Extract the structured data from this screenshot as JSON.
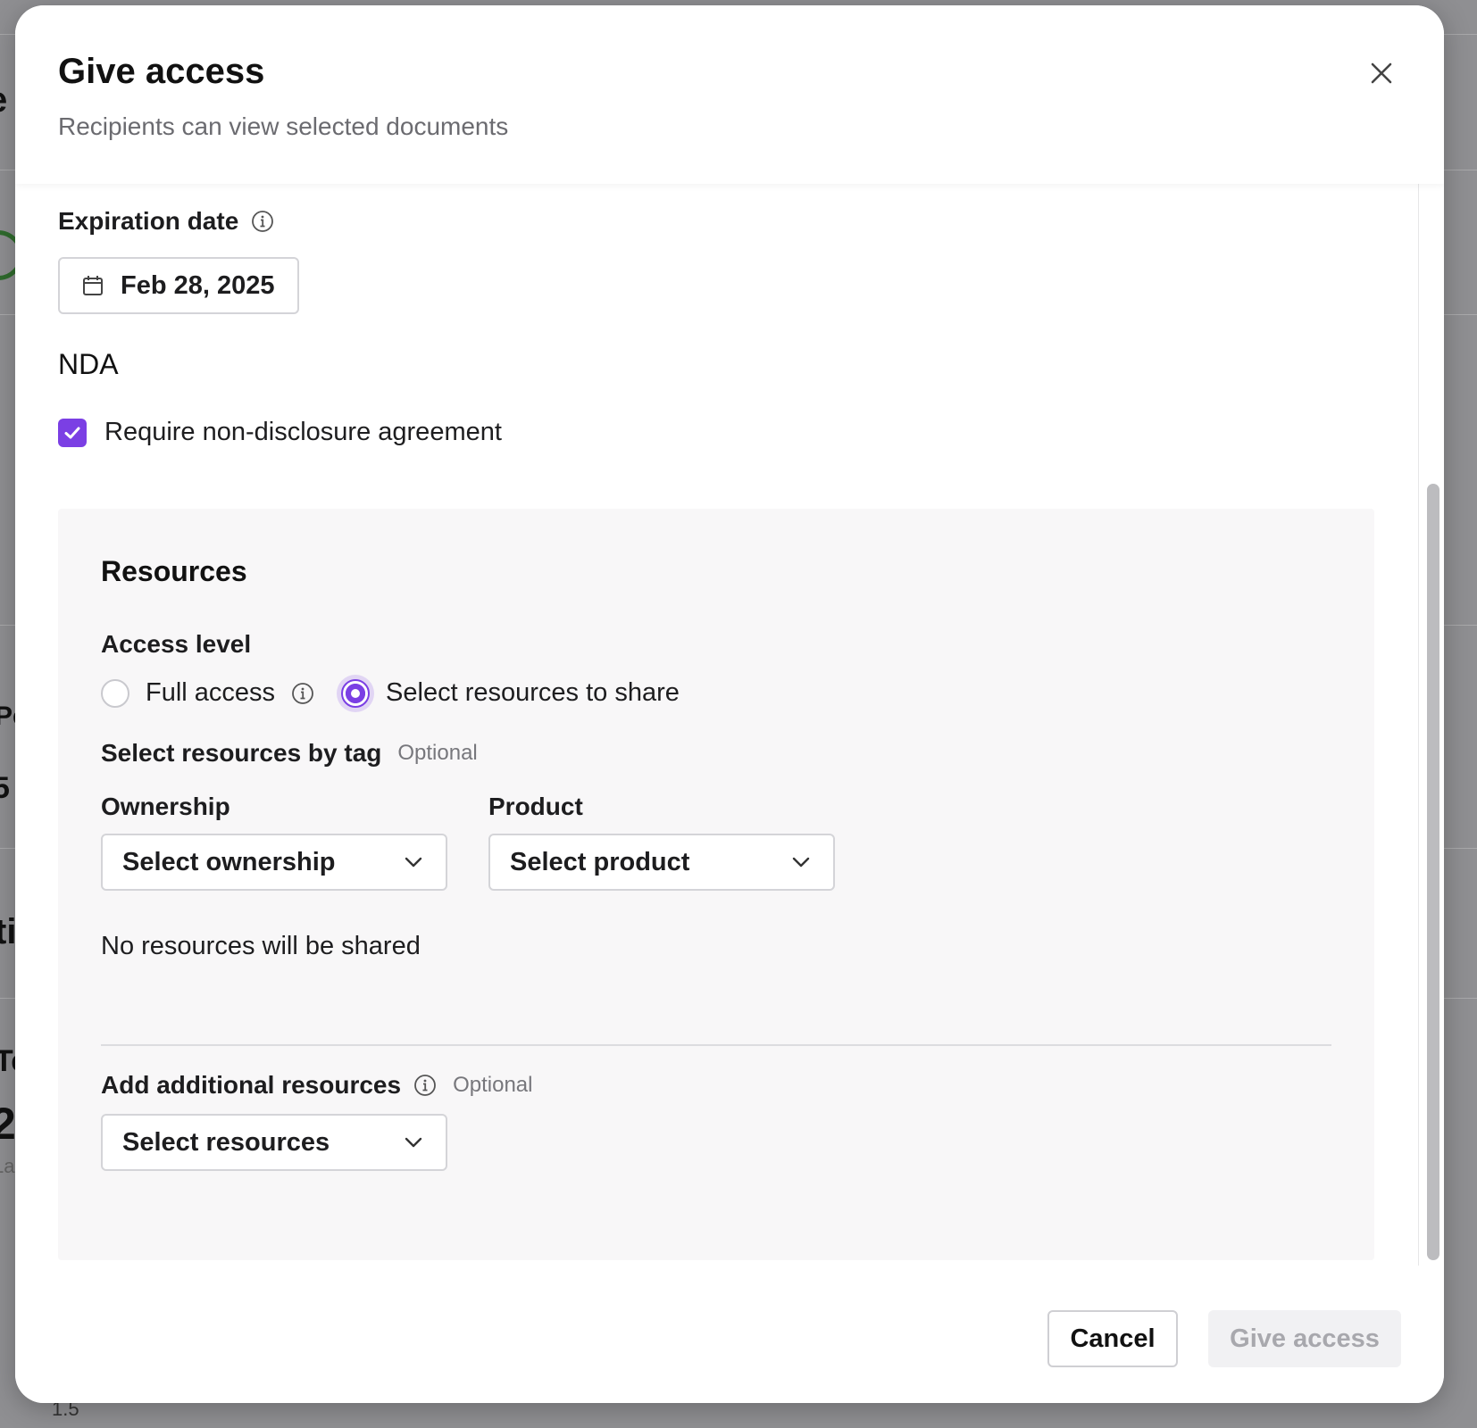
{
  "background": {
    "fragments": [
      "e",
      "Pe",
      "5",
      "ti",
      "Te",
      "2",
      "La"
    ],
    "footer_value": "1.5"
  },
  "modal": {
    "title": "Give access",
    "subtitle": "Recipients can view selected documents"
  },
  "expiration": {
    "label": "Expiration date",
    "value": "Feb 28, 2025"
  },
  "nda": {
    "heading": "NDA",
    "checkbox_label": "Require non-disclosure agreement",
    "checked": true
  },
  "resources": {
    "title": "Resources",
    "access_level": {
      "label": "Access level",
      "options": [
        {
          "label": "Full access",
          "selected": false
        },
        {
          "label": "Select resources to share",
          "selected": true
        }
      ]
    },
    "by_tag": {
      "label": "Select resources by tag",
      "optional": "Optional",
      "ownership": {
        "label": "Ownership",
        "placeholder": "Select ownership"
      },
      "product": {
        "label": "Product",
        "placeholder": "Select product"
      }
    },
    "empty_message": "No resources will be shared",
    "additional": {
      "label": "Add additional resources",
      "optional": "Optional",
      "placeholder": "Select resources"
    }
  },
  "footer": {
    "cancel_label": "Cancel",
    "submit_label": "Give access"
  },
  "colors": {
    "accent": "#7b3fe4",
    "panel_bg": "#f8f7f8",
    "disabled_text": "#a8a8ad"
  }
}
